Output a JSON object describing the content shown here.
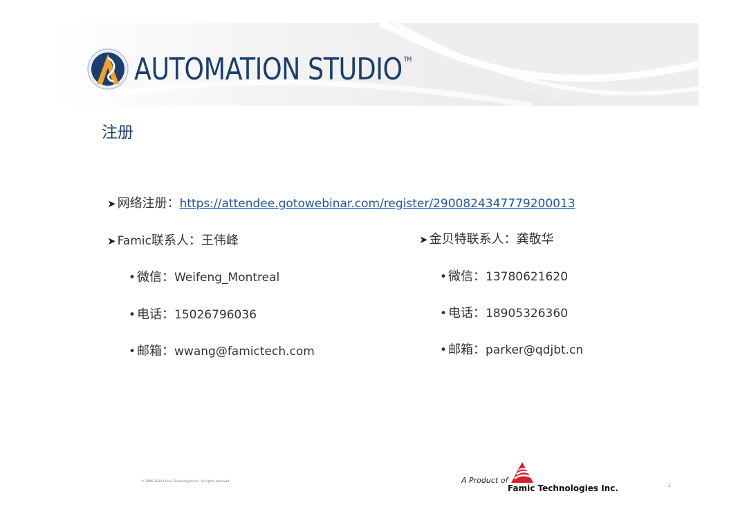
{
  "header": {
    "brand_name": "AUTOMATION STUDIO",
    "trademark": "TM"
  },
  "title": "注册",
  "registration": {
    "label": "网络注册：",
    "url": "https://attendee.gotowebinar.com/register/2900824347779200013"
  },
  "contacts": [
    {
      "prefix_latin": "Famic",
      "heading": "联系人：王伟峰",
      "items": [
        {
          "label": "微信：",
          "value": "Weifeng_Montreal"
        },
        {
          "label": "电话：",
          "value": "15026796036"
        },
        {
          "label": "邮箱：",
          "value": "wwang@famictech.com"
        }
      ]
    },
    {
      "prefix_latin": "",
      "heading": "金贝特联系人：龚敬华",
      "items": [
        {
          "label": "微信：",
          "value": "13780621620"
        },
        {
          "label": "电话：",
          "value": "18905326360"
        },
        {
          "label": "邮箱：",
          "value": "parker@qdjbt.cn"
        }
      ]
    }
  ],
  "footer": {
    "copyright": "© 1986-2019 Famic Technologies Inc. All rights reserved",
    "product_of": "A Product of",
    "company": "Famic Technologies Inc.",
    "page_number": "2"
  },
  "colors": {
    "brand_blue": "#1a3e6e",
    "logo_orange": "#f2a22a",
    "link_blue": "#1f55a8",
    "famic_red": "#d8202a"
  }
}
